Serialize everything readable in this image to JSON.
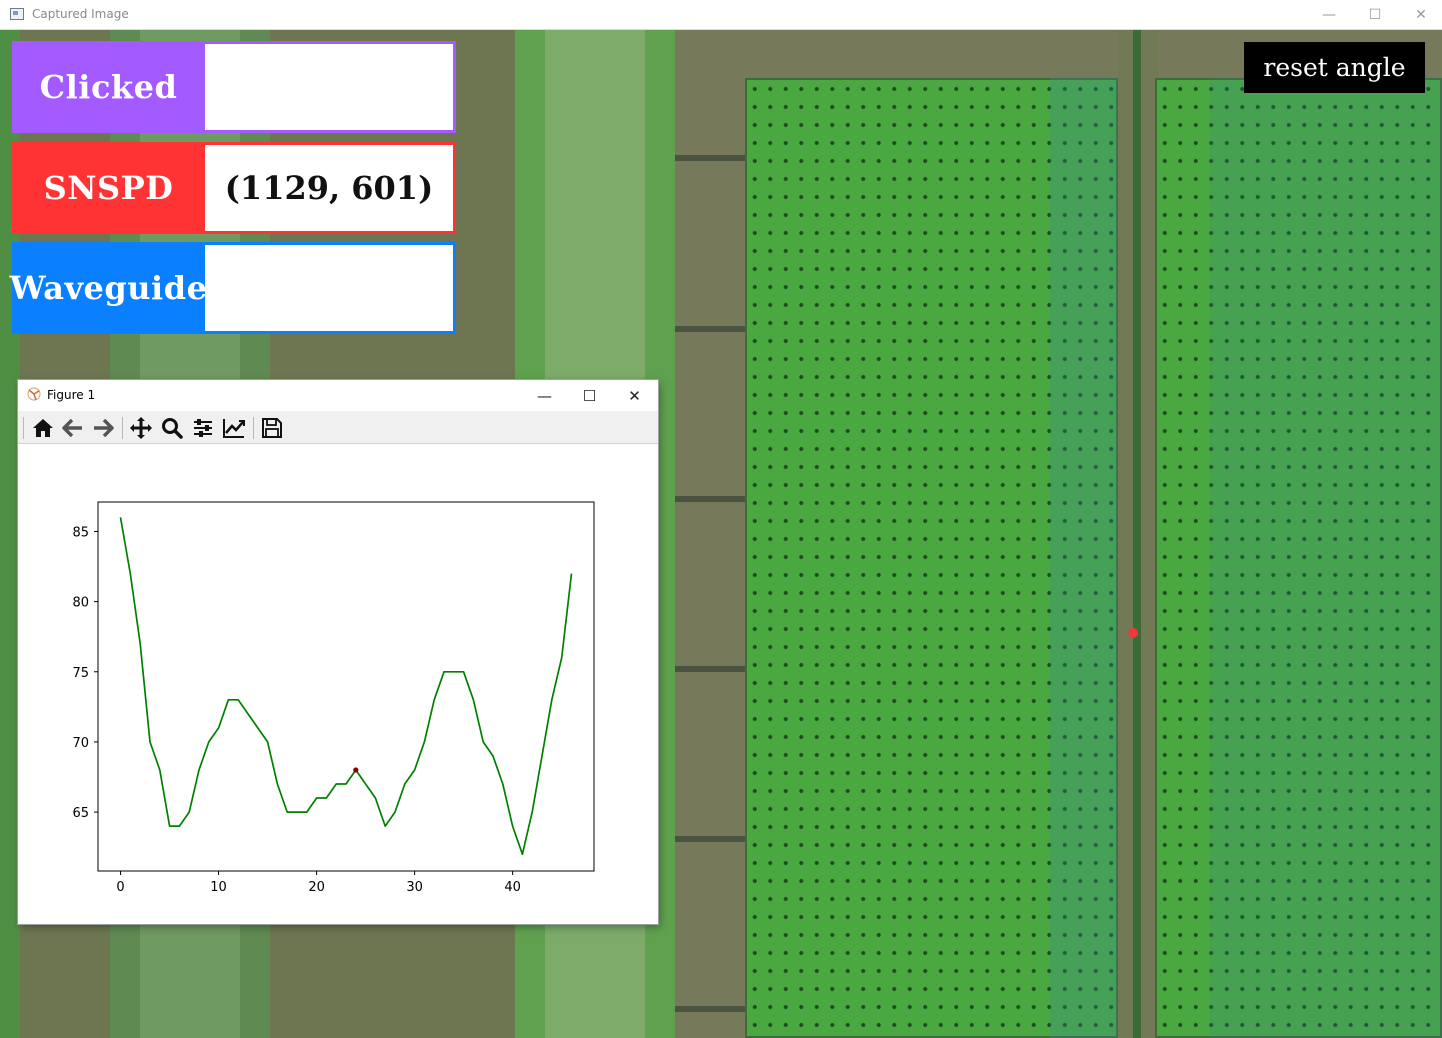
{
  "window": {
    "title": "Captured Image",
    "minimize": "—",
    "maximize": "☐",
    "close": "✕"
  },
  "panels": [
    {
      "label": "Clicked",
      "value": "",
      "color": "#a35bff"
    },
    {
      "label": "SNSPD",
      "value": "(1129, 601)",
      "color": "#ff3333"
    },
    {
      "label": "Waveguide",
      "value": "",
      "color": "#0a7fff"
    }
  ],
  "reset_label": "reset angle",
  "figure": {
    "title": "Figure 1",
    "minimize": "—",
    "maximize": "☐",
    "close": "✕",
    "toolbar": [
      "home-icon",
      "back-icon",
      "forward-icon",
      "pan-icon",
      "zoom-icon",
      "configure-subplots-icon",
      "edit-axis-icon",
      "save-icon"
    ]
  },
  "chart_data": {
    "type": "line",
    "title": "",
    "xlabel": "",
    "ylabel": "",
    "xlim": [
      -2.3,
      48.3
    ],
    "ylim": [
      60.8,
      87.1
    ],
    "xticks": [
      0,
      10,
      20,
      30,
      40
    ],
    "yticks": [
      65,
      70,
      75,
      80,
      85
    ],
    "grid": false,
    "series": [
      {
        "color": "#008000",
        "x": [
          0,
          1,
          2,
          3,
          4,
          5,
          6,
          7,
          8,
          9,
          10,
          11,
          12,
          13,
          14,
          15,
          16,
          17,
          18,
          19,
          20,
          21,
          22,
          23,
          24,
          25,
          26,
          27,
          28,
          29,
          30,
          31,
          32,
          33,
          34,
          35,
          36,
          37,
          38,
          39,
          40,
          41,
          42,
          43,
          44,
          45,
          46
        ],
        "y": [
          86,
          82,
          77,
          70,
          68,
          64,
          64,
          65,
          68,
          70,
          71,
          73,
          73,
          72,
          71,
          70,
          67,
          65,
          65,
          65,
          66,
          66,
          67,
          67,
          68,
          67,
          66,
          64,
          65,
          67,
          68,
          70,
          73,
          75,
          75,
          75,
          73,
          70,
          69,
          67,
          64,
          62,
          65,
          69,
          73,
          76,
          82
        ]
      }
    ],
    "highlight_point": {
      "x": 24,
      "y": 68,
      "color": "#8b0000"
    }
  }
}
